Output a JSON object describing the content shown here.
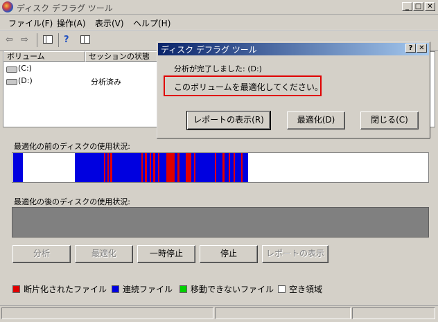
{
  "window": {
    "title": "ディスク デフラグ ツール",
    "caption": {
      "minimize": "_",
      "maximize": "□",
      "close": "✕"
    }
  },
  "menu": [
    "ファイル(F)",
    "操作(A)",
    "表示(V)",
    "ヘルプ(H)"
  ],
  "toolbar_icons": [
    "back-arrow-icon",
    "forward-arrow-icon",
    "console-tree-icon",
    "help-icon",
    "properties-icon"
  ],
  "volumes": {
    "columns": [
      "ボリューム",
      "セッションの状態"
    ],
    "rows": [
      {
        "name": "(C:)",
        "status": ""
      },
      {
        "name": "(D:)",
        "status": "分析済み"
      }
    ]
  },
  "before_label": "最適化の前のディスクの使用状況:",
  "after_label": "最適化の後のディスクの使用状況:",
  "buttons": {
    "analyze": "分析",
    "defrag": "最適化",
    "pause": "一時停止",
    "stop": "停止",
    "view_report": "レポートの表示"
  },
  "legend": [
    {
      "label": "断片化されたファイル",
      "color": "#e00000"
    },
    {
      "label": "連続ファイル",
      "color": "#0000e0"
    },
    {
      "label": "移動できないファイル",
      "color": "#00d000"
    },
    {
      "label": "空き領域",
      "color": "#ffffff"
    }
  ],
  "dialog": {
    "title": "ディスク デフラグ ツール",
    "help": "?",
    "close": "✕",
    "line1": "分析が完了しました: (D:)",
    "line2": "このボリュームを最適化してください。",
    "buttons": {
      "report": "レポートの表示(R)",
      "defrag": "最適化(D)",
      "close": "閉じる(C)"
    }
  }
}
